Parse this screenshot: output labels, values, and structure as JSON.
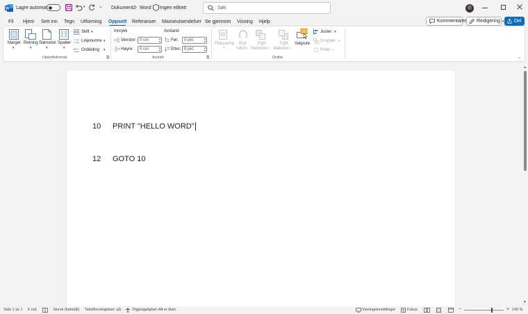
{
  "titlebar": {
    "autosave_label": "Lagre automatisk",
    "autosave_state": "off",
    "document_name": "Dokument2",
    "separator": "-",
    "app_name": "Word",
    "sensitivity_label": "Ingen etikett",
    "search_placeholder": "Søk"
  },
  "menu": {
    "tabs": [
      {
        "label": "Fil"
      },
      {
        "label": "Hjem"
      },
      {
        "label": "Sett inn"
      },
      {
        "label": "Tegn"
      },
      {
        "label": "Utforming"
      },
      {
        "label": "Oppsett",
        "active": true
      },
      {
        "label": "Referanser"
      },
      {
        "label": "Masseutsendelser"
      },
      {
        "label": "Se gjennom"
      },
      {
        "label": "Visning"
      },
      {
        "label": "Hjelp"
      }
    ],
    "comments_label": "Kommentarer",
    "editing_label": "Redigering",
    "share_label": "Del"
  },
  "ribbon": {
    "page_setup": {
      "marger": "Marger",
      "retning": "Retning",
      "storrelse": "Størrelse",
      "spalter": "Spalter",
      "skift": "Skift",
      "linjenumre": "Linjenumre",
      "orddeling": "Orddeling",
      "group_label": "Utskriftsformat"
    },
    "paragraph": {
      "innrykk": "Innrykk",
      "avstand": "Avstand",
      "venstre_label": "Venstre:",
      "venstre_value": "0 cm",
      "hoyre_label": "Høyre:",
      "hoyre_value": "0 cm",
      "for_label": "Før:",
      "for_value": "0 pkt.",
      "etter_label": "Etter:",
      "etter_value": "8 pkt.",
      "group_label": "Avsnitt"
    },
    "arrange": {
      "plassering": "Plassering",
      "bryt_line1": "Bryt",
      "bryt_line2": "tekst",
      "flytt_frem_line1": "Flytt",
      "flytt_frem_line2": "fremover",
      "flytt_bak_line1": "Flytt",
      "flytt_bak_line2": "bakover",
      "valgrute": "Valgrute",
      "juster": "Juster",
      "grupper": "Grupper",
      "roter": "Roter",
      "group_label": "Ordne"
    }
  },
  "document": {
    "lines": [
      {
        "number": "10",
        "text": "PRINT \"HELLO WORD\""
      },
      {
        "number": "12",
        "text": "GOTO 10"
      }
    ]
  },
  "statusbar": {
    "page": "Side 1 av 1",
    "words": "5 ord",
    "language": "Norsk (bokmål)",
    "text_predictions": "Tekstforutsigelser: på",
    "accessibility": "Tilgjengelighet: Alt er klart",
    "display_settings": "Visningsinnstillinger",
    "focus": "Fokus",
    "zoom": "140 %",
    "zoom_level": 0.7
  },
  "colors": {
    "accent": "#1a5ea8",
    "share_button": "#0f6cbd",
    "word_logo": "#185abd"
  }
}
